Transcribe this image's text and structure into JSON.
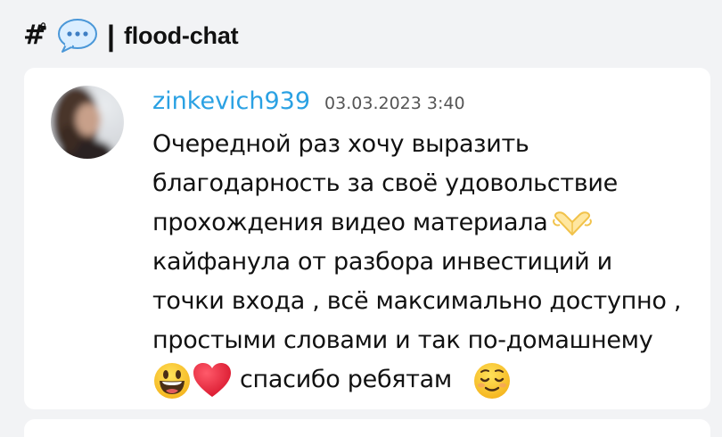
{
  "header": {
    "channel_icon": "hash-lock-icon",
    "bubble_icon": "speech-bubble-icon",
    "separator": "|",
    "channel_name": "flood-chat"
  },
  "message": {
    "username": "zinkevich939",
    "timestamp": "03.03.2023 3:40",
    "lines": [
      "Очередной раз хочу выразить",
      "благодарность за своё удовольствие",
      "прохождения видео материала",
      "кайфанула от разбора инвестиций и",
      "точки входа , всё максимально доступно ,",
      "простыми словами и так по-домашнему",
      "спасибо ребятам"
    ],
    "emojis": {
      "heart_hands": "heart-hands-emoji",
      "smiley": "grinning-face-emoji",
      "heart": "red-heart-emoji",
      "relieved": "relieved-face-emoji"
    }
  },
  "colors": {
    "background": "#f2f3f5",
    "card": "#ffffff",
    "username": "#2aa1e3"
  }
}
